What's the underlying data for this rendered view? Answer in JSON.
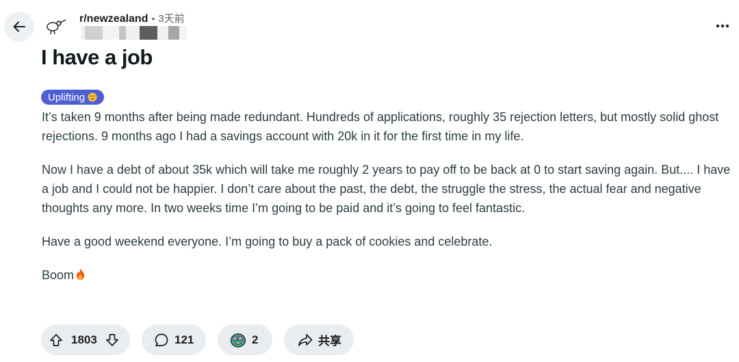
{
  "header": {
    "back_icon": "arrow-left-icon",
    "community_icon": "kiwi-bird-icon",
    "subreddit": "r/newzealand",
    "separator": "•",
    "time": "3天前",
    "more_icon": "more-horizontal-icon"
  },
  "post": {
    "title": "I have a job",
    "flair": "Uplifting",
    "flair_color": "#4f5fd3",
    "paragraphs": [
      "It’s taken 9 months after being made redundant. Hundreds of applications, roughly 35 rejection letters, but mostly solid ghost rejections. 9 months ago I had a savings account with 20k in it for the first time in my life.",
      "Now I have a debt of about 35k which will take me roughly 2 years to pay off to be back at 0 to start saving again. But.... I have a job and I could not be happier. I don’t care about the past, the debt, the struggle the stress, the actual fear and negative thoughts any more. In two weeks time I’m going to be paid and it’s going to feel fantastic.",
      "Have a good weekend everyone. I’m going to buy a pack of cookies and celebrate."
    ],
    "closing": "Boom"
  },
  "actions": {
    "upvotes": "1803",
    "comments": "121",
    "awards": "2",
    "share_label": "共享"
  }
}
